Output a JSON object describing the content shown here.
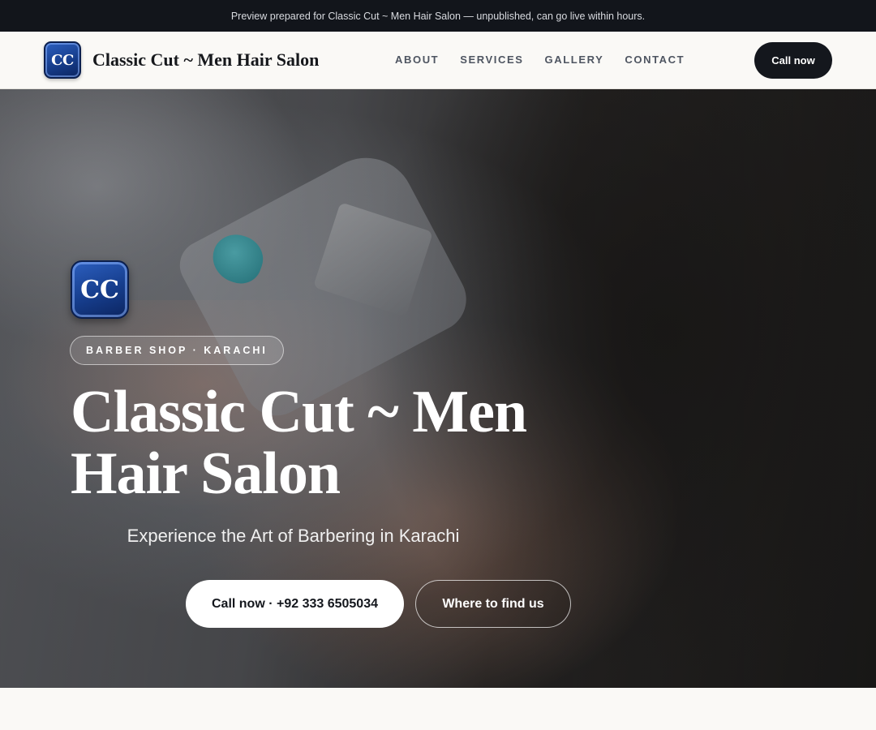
{
  "banner": {
    "text": "Preview prepared for Classic Cut ~ Men Hair Salon — unpublished, can go live within hours."
  },
  "header": {
    "logo_text": "CC",
    "brand_name": "Classic Cut ~ Men Hair Salon",
    "nav": [
      "ABOUT",
      "SERVICES",
      "GALLERY",
      "CONTACT"
    ],
    "cta_label": "Call now"
  },
  "hero": {
    "logo_text": "CC",
    "tag": "BARBER SHOP · KARACHI",
    "title": "Classic Cut ~ Men Hair Salon",
    "subtitle": "Experience the Art of Barbering in Karachi",
    "primary_button": "Call now · +92 333 6505034",
    "secondary_button": "Where to find us"
  },
  "colors": {
    "dark": "#14171d",
    "logo_blue": "#163d8c",
    "page_bg": "#faf9f6"
  }
}
